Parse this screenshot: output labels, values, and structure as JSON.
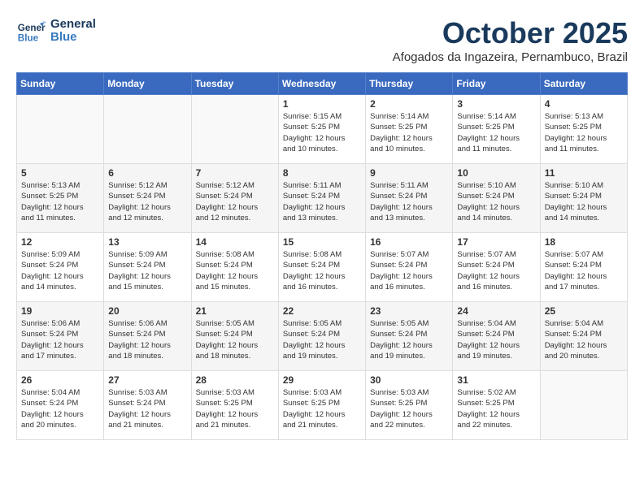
{
  "header": {
    "logo_line1": "General",
    "logo_line2": "Blue",
    "month": "October 2025",
    "location": "Afogados da Ingazeira, Pernambuco, Brazil"
  },
  "days_of_week": [
    "Sunday",
    "Monday",
    "Tuesday",
    "Wednesday",
    "Thursday",
    "Friday",
    "Saturday"
  ],
  "weeks": [
    [
      {
        "day": "",
        "info": ""
      },
      {
        "day": "",
        "info": ""
      },
      {
        "day": "",
        "info": ""
      },
      {
        "day": "1",
        "info": "Sunrise: 5:15 AM\nSunset: 5:25 PM\nDaylight: 12 hours\nand 10 minutes."
      },
      {
        "day": "2",
        "info": "Sunrise: 5:14 AM\nSunset: 5:25 PM\nDaylight: 12 hours\nand 10 minutes."
      },
      {
        "day": "3",
        "info": "Sunrise: 5:14 AM\nSunset: 5:25 PM\nDaylight: 12 hours\nand 11 minutes."
      },
      {
        "day": "4",
        "info": "Sunrise: 5:13 AM\nSunset: 5:25 PM\nDaylight: 12 hours\nand 11 minutes."
      }
    ],
    [
      {
        "day": "5",
        "info": "Sunrise: 5:13 AM\nSunset: 5:25 PM\nDaylight: 12 hours\nand 11 minutes."
      },
      {
        "day": "6",
        "info": "Sunrise: 5:12 AM\nSunset: 5:24 PM\nDaylight: 12 hours\nand 12 minutes."
      },
      {
        "day": "7",
        "info": "Sunrise: 5:12 AM\nSunset: 5:24 PM\nDaylight: 12 hours\nand 12 minutes."
      },
      {
        "day": "8",
        "info": "Sunrise: 5:11 AM\nSunset: 5:24 PM\nDaylight: 12 hours\nand 13 minutes."
      },
      {
        "day": "9",
        "info": "Sunrise: 5:11 AM\nSunset: 5:24 PM\nDaylight: 12 hours\nand 13 minutes."
      },
      {
        "day": "10",
        "info": "Sunrise: 5:10 AM\nSunset: 5:24 PM\nDaylight: 12 hours\nand 14 minutes."
      },
      {
        "day": "11",
        "info": "Sunrise: 5:10 AM\nSunset: 5:24 PM\nDaylight: 12 hours\nand 14 minutes."
      }
    ],
    [
      {
        "day": "12",
        "info": "Sunrise: 5:09 AM\nSunset: 5:24 PM\nDaylight: 12 hours\nand 14 minutes."
      },
      {
        "day": "13",
        "info": "Sunrise: 5:09 AM\nSunset: 5:24 PM\nDaylight: 12 hours\nand 15 minutes."
      },
      {
        "day": "14",
        "info": "Sunrise: 5:08 AM\nSunset: 5:24 PM\nDaylight: 12 hours\nand 15 minutes."
      },
      {
        "day": "15",
        "info": "Sunrise: 5:08 AM\nSunset: 5:24 PM\nDaylight: 12 hours\nand 16 minutes."
      },
      {
        "day": "16",
        "info": "Sunrise: 5:07 AM\nSunset: 5:24 PM\nDaylight: 12 hours\nand 16 minutes."
      },
      {
        "day": "17",
        "info": "Sunrise: 5:07 AM\nSunset: 5:24 PM\nDaylight: 12 hours\nand 16 minutes."
      },
      {
        "day": "18",
        "info": "Sunrise: 5:07 AM\nSunset: 5:24 PM\nDaylight: 12 hours\nand 17 minutes."
      }
    ],
    [
      {
        "day": "19",
        "info": "Sunrise: 5:06 AM\nSunset: 5:24 PM\nDaylight: 12 hours\nand 17 minutes."
      },
      {
        "day": "20",
        "info": "Sunrise: 5:06 AM\nSunset: 5:24 PM\nDaylight: 12 hours\nand 18 minutes."
      },
      {
        "day": "21",
        "info": "Sunrise: 5:05 AM\nSunset: 5:24 PM\nDaylight: 12 hours\nand 18 minutes."
      },
      {
        "day": "22",
        "info": "Sunrise: 5:05 AM\nSunset: 5:24 PM\nDaylight: 12 hours\nand 19 minutes."
      },
      {
        "day": "23",
        "info": "Sunrise: 5:05 AM\nSunset: 5:24 PM\nDaylight: 12 hours\nand 19 minutes."
      },
      {
        "day": "24",
        "info": "Sunrise: 5:04 AM\nSunset: 5:24 PM\nDaylight: 12 hours\nand 19 minutes."
      },
      {
        "day": "25",
        "info": "Sunrise: 5:04 AM\nSunset: 5:24 PM\nDaylight: 12 hours\nand 20 minutes."
      }
    ],
    [
      {
        "day": "26",
        "info": "Sunrise: 5:04 AM\nSunset: 5:24 PM\nDaylight: 12 hours\nand 20 minutes."
      },
      {
        "day": "27",
        "info": "Sunrise: 5:03 AM\nSunset: 5:24 PM\nDaylight: 12 hours\nand 21 minutes."
      },
      {
        "day": "28",
        "info": "Sunrise: 5:03 AM\nSunset: 5:25 PM\nDaylight: 12 hours\nand 21 minutes."
      },
      {
        "day": "29",
        "info": "Sunrise: 5:03 AM\nSunset: 5:25 PM\nDaylight: 12 hours\nand 21 minutes."
      },
      {
        "day": "30",
        "info": "Sunrise: 5:03 AM\nSunset: 5:25 PM\nDaylight: 12 hours\nand 22 minutes."
      },
      {
        "day": "31",
        "info": "Sunrise: 5:02 AM\nSunset: 5:25 PM\nDaylight: 12 hours\nand 22 minutes."
      },
      {
        "day": "",
        "info": ""
      }
    ]
  ]
}
